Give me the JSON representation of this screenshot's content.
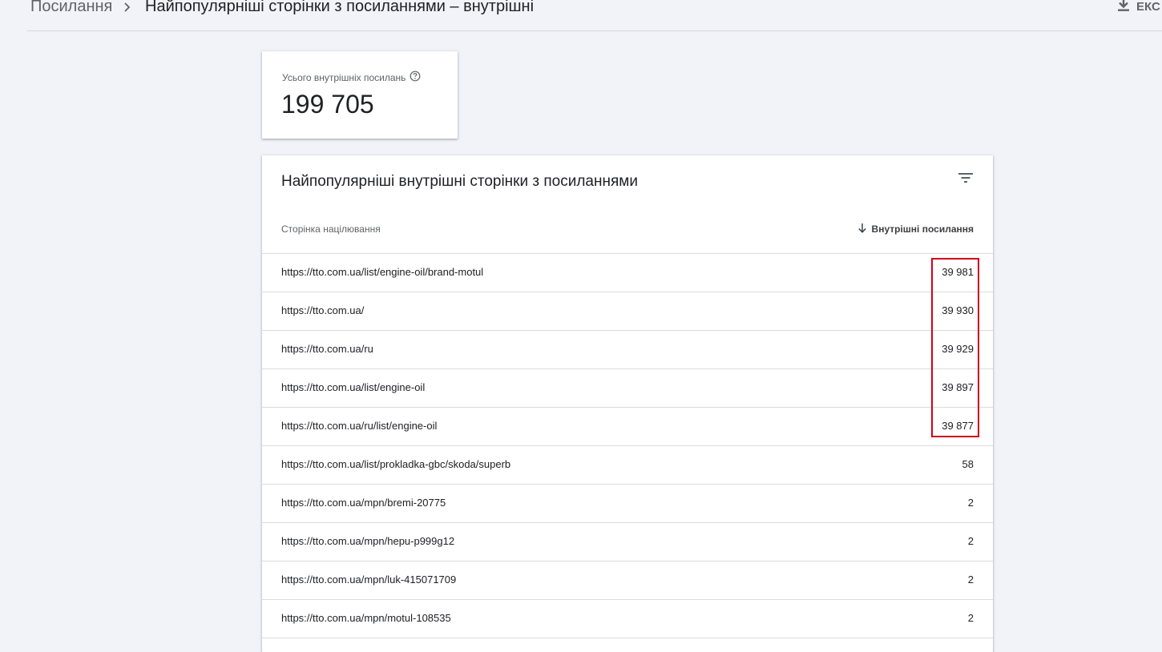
{
  "breadcrumb": {
    "root": "Посилання",
    "current": "Найпопулярніші сторінки з посиланнями – внутрішні"
  },
  "export": {
    "label": "ЕКС",
    "icon": "download-icon"
  },
  "summary": {
    "label": "Усього внутрішніх посилань",
    "value": "199 705",
    "help_icon": "help-circle-icon"
  },
  "table": {
    "title": "Найпопулярніші внутрішні сторінки з посиланнями",
    "filter_icon": "filter-icon",
    "columns": {
      "page": "Сторінка націлювання",
      "links": "Внутрішні посилання",
      "sort_icon": "arrow-down-icon"
    },
    "rows": [
      {
        "url": "https://tto.com.ua/list/engine-oil/brand-motul",
        "count": "39 981"
      },
      {
        "url": "https://tto.com.ua/",
        "count": "39 930"
      },
      {
        "url": "https://tto.com.ua/ru",
        "count": "39 929"
      },
      {
        "url": "https://tto.com.ua/list/engine-oil",
        "count": "39 897"
      },
      {
        "url": "https://tto.com.ua/ru/list/engine-oil",
        "count": "39 877"
      },
      {
        "url": "https://tto.com.ua/list/prokladka-gbc/skoda/superb",
        "count": "58"
      },
      {
        "url": "https://tto.com.ua/mpn/bremi-20775",
        "count": "2"
      },
      {
        "url": "https://tto.com.ua/mpn/hepu-p999g12",
        "count": "2"
      },
      {
        "url": "https://tto.com.ua/mpn/luk-415071709",
        "count": "2"
      },
      {
        "url": "https://tto.com.ua/mpn/motul-108535",
        "count": "2"
      }
    ]
  },
  "colors": {
    "background": "#f1f3f8",
    "highlight": "#d0021b"
  }
}
